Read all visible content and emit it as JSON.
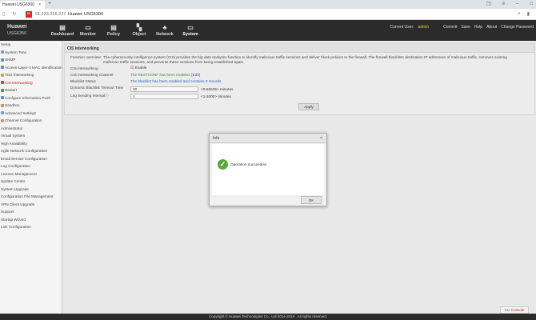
{
  "browser": {
    "tab_title": "Huawei USG6300",
    "close": "×",
    "new_tab": "+",
    "url": "91.233.226.237",
    "page_title": "Huawei USG6300",
    "favicon": "H"
  },
  "header": {
    "brand": "Huawei",
    "model": "USG6350",
    "menus": [
      {
        "label": "Dashboard",
        "icon": "▤"
      },
      {
        "label": "Monitor",
        "icon": "▭"
      },
      {
        "label": "Policy",
        "icon": "▤"
      },
      {
        "label": "Object",
        "icon": "▚"
      },
      {
        "label": "Network",
        "icon": "♣"
      },
      {
        "label": "System",
        "icon": "▭"
      }
    ],
    "current_user_label": "Current User:",
    "current_user": "admin",
    "links": [
      "Commit",
      "Save",
      "Help",
      "About",
      "Change Password"
    ]
  },
  "sidebar": {
    "items": [
      {
        "label": "Setup"
      },
      {
        "label": "System Time",
        "color": "#7a9ac0"
      },
      {
        "label": "SNMP",
        "color": "#4b8fd0"
      },
      {
        "label": "Access-Layer-3 MAC Identification",
        "color": "#4b8fd0"
      },
      {
        "label": "TDS Interworking",
        "color": "#e0a030"
      },
      {
        "label": "CIS Interworking",
        "color": "#d04040"
      },
      {
        "label": "Restart",
        "color": "#40a040"
      },
      {
        "label": "Configure Information Push",
        "color": "#4b8fd0"
      },
      {
        "label": "Sandbox",
        "color": "#e09030"
      },
      {
        "label": "Advanced Settings",
        "color": "#7a9ac0"
      },
      {
        "label": "Channel Configuration",
        "color": "#c0a060"
      },
      {
        "label": "Administrator"
      },
      {
        "label": "Virtual System"
      },
      {
        "label": "High Availability"
      },
      {
        "label": "Agile Network Configuration"
      },
      {
        "label": "Email Service Configuration"
      },
      {
        "label": "Log Configuration"
      },
      {
        "label": "License Management"
      },
      {
        "label": "Update Center"
      },
      {
        "label": "System Upgrade"
      },
      {
        "label": "Configuration File Management"
      },
      {
        "label": "VPN Client Upgrade"
      },
      {
        "label": "Support"
      },
      {
        "label": "Startup Wizard"
      },
      {
        "label": "Link Configuration"
      }
    ]
  },
  "panel": {
    "title": "CIS Interworking",
    "overview_label": "Function overview:",
    "overview_text": "The cybersecurity intelligence system (CIS) provides the big data analytics function to identify malicious traffic sessions and deliver block policies to the firewall. The firewall blacklists destination IP addresses of malicious traffic, removes existing malicious traffic sessions, and prevents these sessions from being established again.",
    "cis_label": "CIS Interworking",
    "enable_label": "Enable",
    "enabled": true,
    "channel_label": "CIS Interworking Channel",
    "channel_value": "The RESTCONF has been enabled.",
    "edit_link": "[Edit]",
    "blacklist_label": "Blacklist Status",
    "blacklist_value": "The blacklist has been enabled and contains 0 records.",
    "timeout_label": "Dynamic Blacklist Timeout Time",
    "timeout_value": "30",
    "timeout_hint": "<0-65535> minutes",
    "log_label": "Log Sending Interval",
    "log_value": "1",
    "log_hint": "<1-1000> minutes",
    "apply": "Apply"
  },
  "dialog": {
    "title": "Info",
    "close": "×",
    "message": "Operation succeeded.",
    "ok": "OK"
  },
  "cli_console": "CLI Console",
  "footer": "Copyright © Huawei Technologies Co., Ltd.2014-2018 . All rights reserved."
}
